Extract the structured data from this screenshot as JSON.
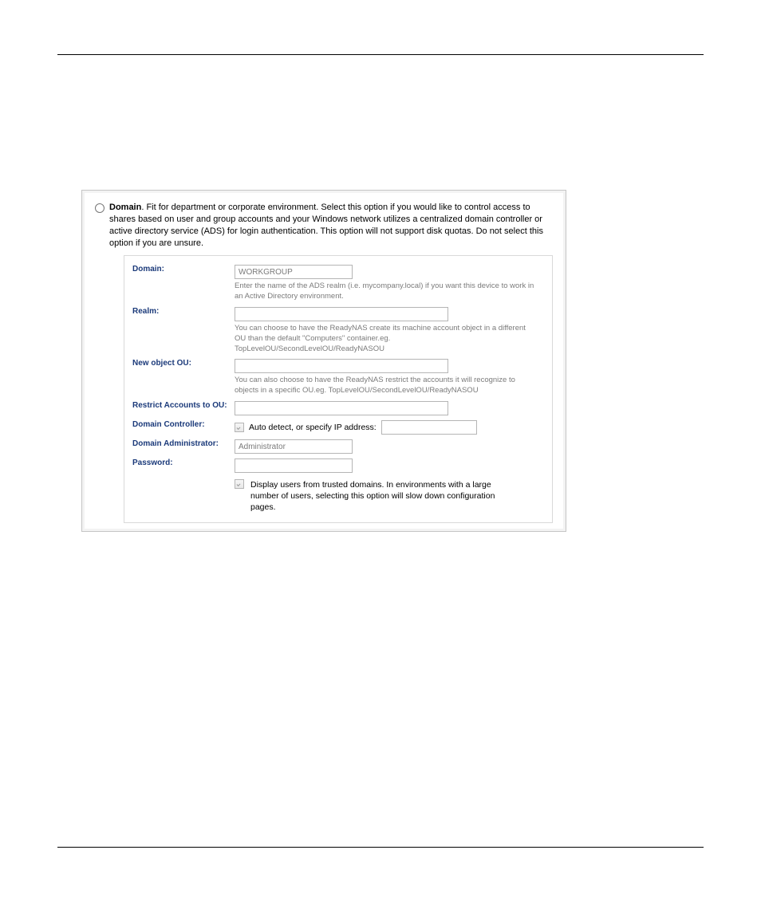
{
  "header": {
    "option_title": "Domain",
    "option_description": ". Fit for department or corporate environment. Select this option if you would like to control access to shares based on user and group accounts and your Windows network utilizes a centralized domain controller or active directory service (ADS) for login authentication. This option will not support disk quotas. Do not select this option if you are unsure."
  },
  "form": {
    "domain": {
      "label": "Domain:",
      "value": "WORKGROUP",
      "hint": "Enter the name of the ADS realm (i.e. mycompany.local) if you want this device to work in an Active Directory environment."
    },
    "realm": {
      "label": "Realm:",
      "value": "",
      "hint": "You can choose to have the ReadyNAS create its machine account object in a different OU than the default \"Computers\" container.eg. TopLevelOU/SecondLevelOU/ReadyNASOU"
    },
    "new_object_ou": {
      "label": "New object OU:",
      "value": "",
      "hint": "You can also choose to have the ReadyNAS restrict the accounts it will recognize to objects in a specific OU.eg. TopLevelOU/SecondLevelOU/ReadyNASOU"
    },
    "restrict_ou": {
      "label": "Restrict Accounts to OU:",
      "value": ""
    },
    "domain_controller": {
      "label": "Domain Controller:",
      "checkbox_label": "Auto detect, or specify IP address:",
      "ip_value": ""
    },
    "domain_admin": {
      "label": "Domain Administrator:",
      "value": "Administrator"
    },
    "password": {
      "label": "Password:",
      "value": ""
    },
    "trusted_domains": {
      "text": "Display users from trusted domains. In environments with a large number of users, selecting this option will slow down configuration pages."
    }
  }
}
